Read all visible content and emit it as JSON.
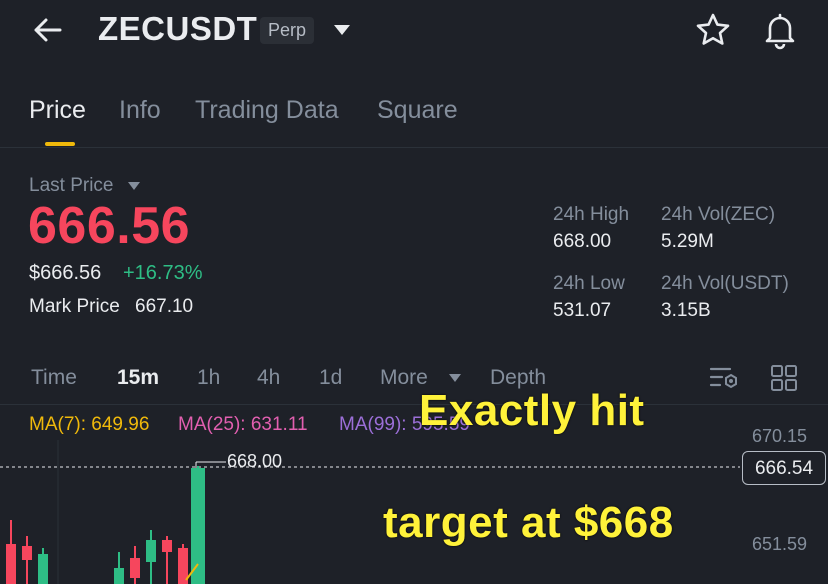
{
  "header": {
    "symbol": "ZECUSDT",
    "badge": "Perp"
  },
  "tabs": [
    {
      "label": "Price",
      "active": true
    },
    {
      "label": "Info"
    },
    {
      "label": "Trading Data"
    },
    {
      "label": "Square"
    }
  ],
  "price": {
    "last_price_label": "Last Price",
    "last_price": "666.56",
    "usd_price": "$666.56",
    "change_pct": "+16.73%",
    "mark_label": "Mark Price",
    "mark_value": "667.10"
  },
  "stats": {
    "high_label": "24h High",
    "high_value": "668.00",
    "vol_base_label": "24h Vol(ZEC)",
    "vol_base_value": "5.29M",
    "low_label": "24h Low",
    "low_value": "531.07",
    "vol_quote_label": "24h Vol(USDT)",
    "vol_quote_value": "3.15B"
  },
  "intervals": [
    "Time",
    "15m",
    "1h",
    "4h",
    "1d",
    "More",
    "Depth"
  ],
  "active_interval": "15m",
  "ma": {
    "ma7": "MA(7): 649.96",
    "ma25": "MA(25): 631.11",
    "ma99": "MA(99): 595.59"
  },
  "chart": {
    "price_high": "670.15",
    "price_low": "651.59",
    "current_price": "666.54",
    "high_marker": "668.00"
  },
  "overlay": {
    "line1": "Exactly hit",
    "line2": "target at $668"
  },
  "colors": {
    "up": "#2ebd85",
    "down": "#f6465d",
    "accent": "#f0b90b"
  }
}
